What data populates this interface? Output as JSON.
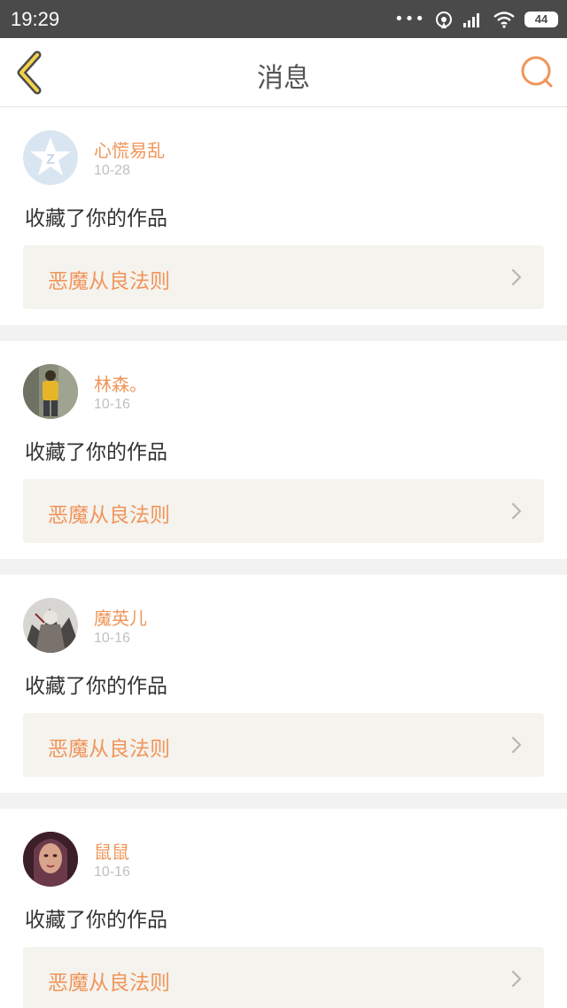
{
  "status_bar": {
    "time": "19:29",
    "dots": "•••",
    "battery": "44"
  },
  "header": {
    "title": "消息",
    "back_icon": "back-chevron-icon",
    "search_icon": "search-icon"
  },
  "accent_color": "#f0955a",
  "messages": [
    {
      "user": "心慌易乱",
      "date": "10-28",
      "text": "收藏了你的作品",
      "work": "恶魔从良法则"
    },
    {
      "user": "林森。",
      "date": "10-16",
      "text": "收藏了你的作品",
      "work": "恶魔从良法则"
    },
    {
      "user": "魔英儿",
      "date": "10-16",
      "text": "收藏了你的作品",
      "work": "恶魔从良法则"
    },
    {
      "user": "鼠鼠",
      "date": "10-16",
      "text": "收藏了你的作品",
      "work": "恶魔从良法则"
    }
  ]
}
